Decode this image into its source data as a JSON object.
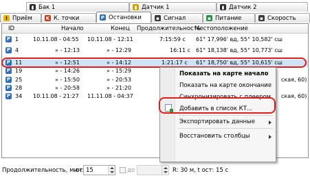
{
  "tabs_row1": [
    {
      "label": "Бак 1",
      "icon": "fuel-icon",
      "color": "#2b2b2b"
    },
    {
      "label": "Датчик 1",
      "icon": "sensor-icon",
      "color": "#c9a400"
    },
    {
      "label": "Датчик 2",
      "icon": "sensor-icon",
      "color": "#2b2b2b"
    }
  ],
  "tabs_row2": [
    {
      "label": "Приём",
      "icon": "warning-icon",
      "color": "#e8b400"
    },
    {
      "label": "К. точки",
      "icon": "checkpoint-icon",
      "color": "#c43a12"
    },
    {
      "label": "Остановки",
      "icon": "parking-icon",
      "color": "#2e6fb8"
    },
    {
      "label": "Сигнал",
      "icon": "signal-icon",
      "color": "#3a3a3a"
    },
    {
      "label": "Питание",
      "icon": "power-icon",
      "color": "#2d8f4a"
    },
    {
      "label": "Скорость",
      "icon": "speed-icon",
      "color": "#3a3a3a"
    }
  ],
  "table": {
    "headers": {
      "id": "ID",
      "start": "Начало",
      "end": "Конец",
      "duration": "Продолжительность",
      "location": "Местоположение"
    },
    "rows": [
      {
        "id": "1",
        "start": "10.11.08 - 04:55",
        "end": "10.11.08 - 12:11",
        "duration": "7:15:59 с",
        "location": "61° 17,996' вд, 55° 10,582' сш"
      },
      {
        "id": "4",
        "start": "» - 12:13",
        "end": "» - 12:29",
        "duration": "16:11 с",
        "location": "61° 18,138' вд, 55° 10,773' сш"
      },
      {
        "id": "11",
        "start": "» - 12:51",
        "end": "» - 14:12",
        "duration": "1:21:17 с",
        "location": "61° 18,750' вд, 55° 10,615' сш"
      },
      {
        "id": "19",
        "start": "» - 14:26",
        "end": "» - 15:29",
        "duration": "",
        "location": ""
      },
      {
        "id": "25",
        "start": "» - 15:50",
        "end": "» - 20:53",
        "duration": "",
        "location": "ская, 60)"
      },
      {
        "id": "28",
        "start": "» - 20:58",
        "end": "» - 21:20",
        "duration": "",
        "location": ""
      },
      {
        "id": "34",
        "start": "10.11.08 - 21:27",
        "end": "11.11.08 - 04:37",
        "duration": "",
        "location": "ская, 60)"
      }
    ]
  },
  "context_menu": {
    "show_on_map_start": "Показать на карте начало",
    "show_on_map_end": "Показать на карте окончание",
    "sync_player": "Синхронизировать с плеером",
    "add_to_kt": "Добавить в список КТ...",
    "export": "Экспортировать данные",
    "restore_columns": "Восстановить столбцы"
  },
  "bottom": {
    "duration_label": "Продолжительность, мин:",
    "from_label": "от",
    "from_value": "15",
    "to_label": "до",
    "to_value": "",
    "summary": "R: 30 м, t ост: 15 с"
  }
}
